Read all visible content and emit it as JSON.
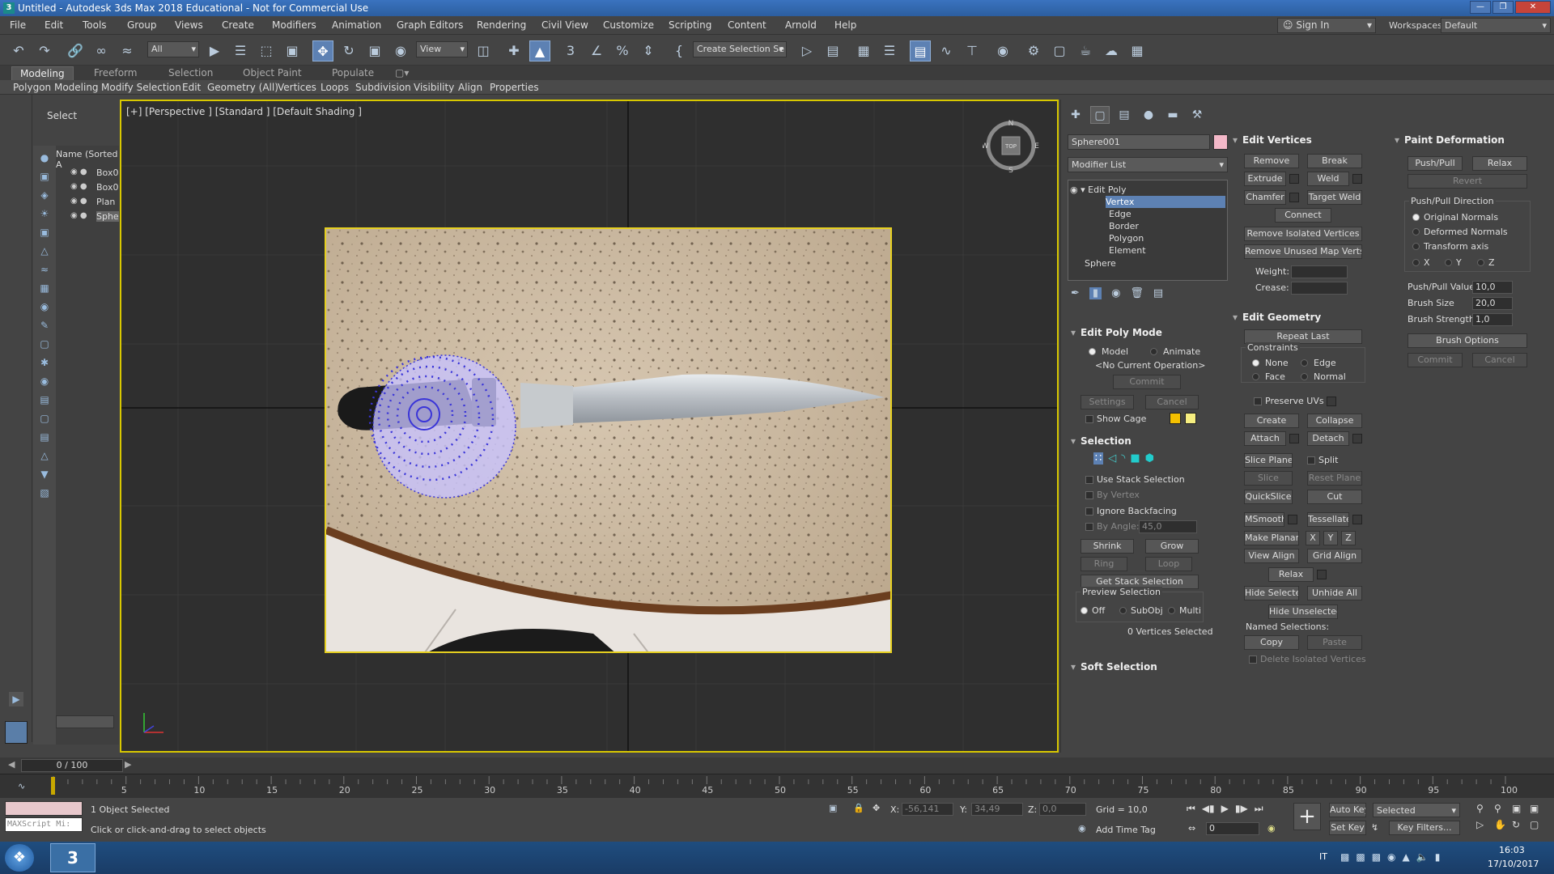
{
  "app": {
    "title": "Untitled - Autodesk 3ds Max 2018 Educational  - Not for Commercial Use",
    "logo": "3"
  },
  "menubar": {
    "items": [
      "File",
      "Edit",
      "Tools",
      "Group",
      "Views",
      "Create",
      "Modifiers",
      "Animation",
      "Graph Editors",
      "Rendering",
      "Civil View",
      "Customize",
      "Scripting",
      "Content",
      "Arnold",
      "Help"
    ],
    "sign_in": "Sign In",
    "workspaces_label": "Workspaces:",
    "workspace_value": "Default"
  },
  "toolbar": {
    "filter_value": "All",
    "view_value": "View",
    "selection_set": "Create Selection Se"
  },
  "ribbon": {
    "tabs": [
      "Modeling",
      "Freeform",
      "Selection",
      "Object Paint",
      "Populate"
    ],
    "subitems": [
      "Polygon Modeling",
      "Modify Selection",
      "Edit",
      "Geometry (All)",
      "Vertices",
      "Loops",
      "Subdivision",
      "Visibility",
      "Align",
      "Properties"
    ]
  },
  "scene_explorer": {
    "select_label": "Select",
    "header": "Name (Sorted A",
    "rows": [
      "Box0",
      "Box0",
      "Plan",
      "Sphe"
    ]
  },
  "viewport": {
    "label": "[+] [Perspective ] [Standard ] [Default Shading ]",
    "compass": {
      "n": "N",
      "s": "S",
      "w": "W",
      "e": "E",
      "top": "TOP"
    }
  },
  "command_panel": {
    "object_name": "Sphere001",
    "object_color": "#f3b8c8",
    "modifier_list": "Modifier List",
    "stack": [
      "Edit Poly",
      "Vertex",
      "Edge",
      "Border",
      "Polygon",
      "Element",
      "Sphere"
    ],
    "edit_poly_mode": {
      "title": "Edit Poly Mode",
      "model": "Model",
      "animate": "Animate",
      "operation": "<No Current Operation>",
      "commit": "Commit",
      "settings": "Settings",
      "cancel": "Cancel",
      "show_cage": "Show Cage"
    },
    "selection": {
      "title": "Selection",
      "use_stack": "Use Stack Selection",
      "by_vertex": "By Vertex",
      "ignore_backfacing": "Ignore Backfacing",
      "by_angle": "By Angle:",
      "by_angle_value": "45,0",
      "shrink": "Shrink",
      "grow": "Grow",
      "ring": "Ring",
      "loop": "Loop",
      "get_stack": "Get Stack Selection",
      "preview": "Preview Selection",
      "off": "Off",
      "subobj": "SubObj",
      "multi": "Multi",
      "status": "0 Vertices Selected"
    },
    "soft_selection": "Soft Selection",
    "edit_vertices": {
      "title": "Edit Vertices",
      "remove": "Remove",
      "break": "Break",
      "extrude": "Extrude",
      "weld": "Weld",
      "chamfer": "Chamfer",
      "target_weld": "Target Weld",
      "connect": "Connect",
      "remove_isolated": "Remove Isolated Vertices",
      "remove_unused": "Remove Unused Map Verts",
      "weight": "Weight:",
      "crease": "Crease:"
    },
    "edit_geometry": {
      "title": "Edit Geometry",
      "repeat_last": "Repeat Last",
      "constraints": "Constraints",
      "none": "None",
      "edge": "Edge",
      "face": "Face",
      "normal": "Normal",
      "preserve_uvs": "Preserve UVs",
      "create": "Create",
      "collapse": "Collapse",
      "attach": "Attach",
      "detach": "Detach",
      "slice_plane": "Slice Plane",
      "split": "Split",
      "slice": "Slice",
      "reset_plane": "Reset Plane",
      "quickslice": "QuickSlice",
      "cut": "Cut",
      "msmooth": "MSmooth",
      "tessellate": "Tessellate",
      "make_planar": "Make Planar",
      "x": "X",
      "y": "Y",
      "z": "Z",
      "view_align": "View Align",
      "grid_align": "Grid Align",
      "relax": "Relax",
      "hide_selected": "Hide Selected",
      "unhide_all": "Unhide All",
      "hide_unselected": "Hide Unselected",
      "named_selections": "Named Selections:",
      "copy": "Copy",
      "paste": "Paste",
      "delete_isolated": "Delete Isolated Vertices"
    },
    "paint_deformation": {
      "title": "Paint Deformation",
      "push_pull": "Push/Pull",
      "relax": "Relax",
      "revert": "Revert",
      "direction": "Push/Pull Direction",
      "original_normals": "Original Normals",
      "deformed_normals": "Deformed Normals",
      "transform_axis": "Transform axis",
      "x": "X",
      "y": "Y",
      "z": "Z",
      "push_pull_value_label": "Push/Pull Value",
      "push_pull_value": "10,0",
      "brush_size_label": "Brush Size",
      "brush_size": "20,0",
      "brush_strength_label": "Brush Strength",
      "brush_strength": "1,0",
      "brush_options": "Brush Options",
      "commit": "Commit",
      "cancel": "Cancel"
    }
  },
  "timeline": {
    "frame": "0 / 100",
    "ticks": [
      "5",
      "10",
      "15",
      "20",
      "25",
      "30",
      "35",
      "40",
      "45",
      "50",
      "55",
      "60",
      "65",
      "70",
      "75",
      "80",
      "85",
      "90",
      "95",
      "100"
    ]
  },
  "status": {
    "maxscript": "MAXScript Mi:",
    "objects_selected": "1 Object Selected",
    "prompt": "Click or click-and-drag to select objects",
    "x_label": "X:",
    "x_value": "-56,141",
    "y_label": "Y:",
    "y_value": "34,49",
    "z_label": "Z:",
    "z_value": "0,0",
    "grid": "Grid = 10,0",
    "add_time_tag": "Add Time Tag",
    "auto_key": "Auto Key",
    "key_mode": "Selected",
    "set_key": "Set Key",
    "key_filters": "Key Filters...",
    "frame_value": "0"
  },
  "taskbar": {
    "lang": "IT",
    "time": "16:03",
    "date": "17/10/2017"
  }
}
